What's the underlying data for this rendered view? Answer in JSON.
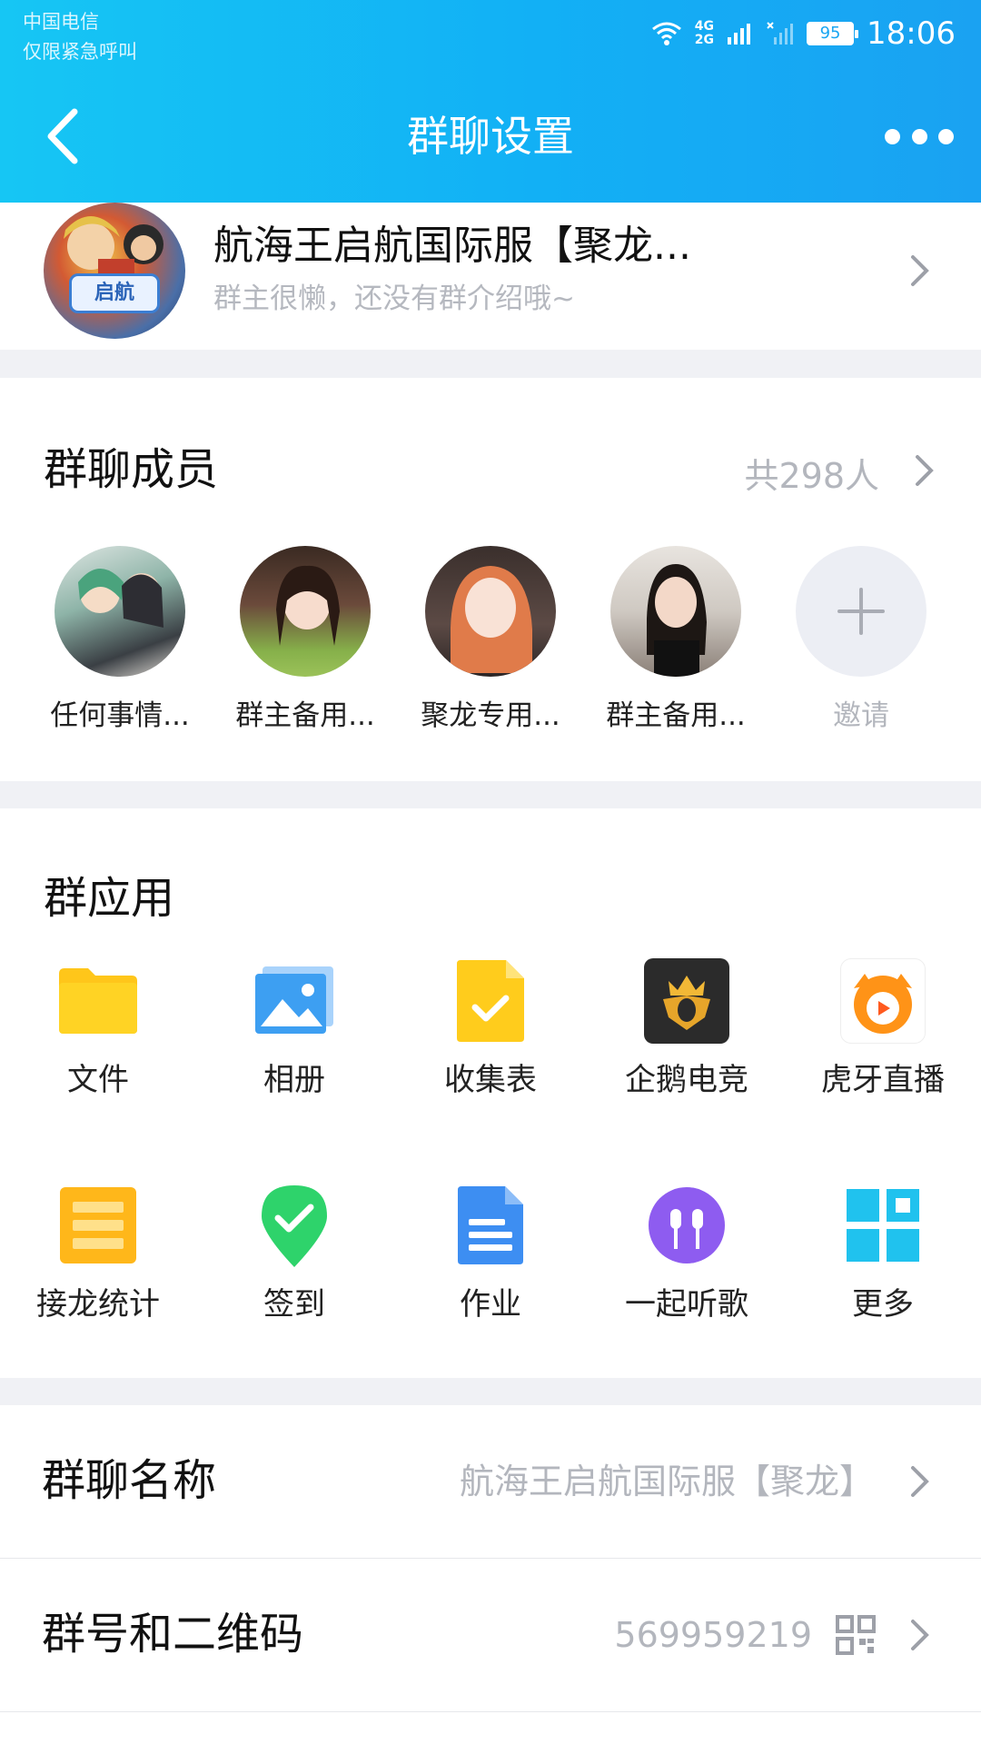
{
  "status_bar": {
    "carrier": "中国电信",
    "carrier_sub": "仅限紧急呼叫",
    "network": "4G",
    "network2": "2G",
    "battery": "95",
    "time": "18:06"
  },
  "header": {
    "title": "群聊设置",
    "back_icon": "chevron-left-icon",
    "more_icon": "more-dots-icon"
  },
  "group": {
    "name": "航海王启航国际服【聚龙...",
    "description": "群主很懒，还没有群介绍哦~",
    "avatar_logo_text": "启航"
  },
  "members_section": {
    "title": "群聊成员",
    "count": "共298人",
    "members": [
      {
        "name": "任何事情..."
      },
      {
        "name": "群主备用..."
      },
      {
        "name": "聚龙专用..."
      },
      {
        "name": "群主备用..."
      }
    ],
    "invite_label": "邀请"
  },
  "apps_section": {
    "title": "群应用",
    "apps": [
      {
        "label": "文件",
        "icon": "folder-icon",
        "color": "#ffc61a"
      },
      {
        "label": "相册",
        "icon": "photo-album-icon",
        "color": "#3d9ff2"
      },
      {
        "label": "收集表",
        "icon": "form-check-icon",
        "color": "#ffc61a"
      },
      {
        "label": "企鹅电竞",
        "icon": "penguin-esports-icon",
        "color": "#2b2b2b"
      },
      {
        "label": "虎牙直播",
        "icon": "huya-tiger-icon",
        "color": "#ff9317"
      },
      {
        "label": "接龙统计",
        "icon": "list-stats-icon",
        "color": "#ffb71a"
      },
      {
        "label": "签到",
        "icon": "checkin-pin-icon",
        "color": "#2ed36b"
      },
      {
        "label": "作业",
        "icon": "homework-doc-icon",
        "color": "#3d8ef2"
      },
      {
        "label": "一起听歌",
        "icon": "earphones-icon",
        "color": "#8e5cf0"
      },
      {
        "label": "更多",
        "icon": "grid-more-icon",
        "color": "#20c2ee"
      }
    ]
  },
  "rows": {
    "name_label": "群聊名称",
    "name_value": "航海王启航国际服【聚龙】",
    "number_label": "群号和二维码",
    "number_value": "569959219"
  }
}
